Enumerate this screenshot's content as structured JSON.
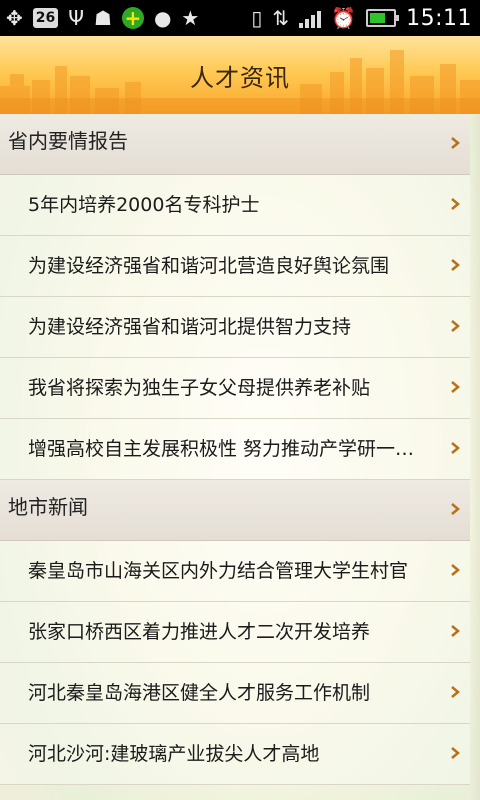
{
  "status_bar": {
    "badge": "26",
    "time": "15:11"
  },
  "header": {
    "title": "人才资讯"
  },
  "sections": [
    {
      "title": "省内要情报告",
      "items": [
        "5年内培养2000名专科护士",
        "为建设经济强省和谐河北营造良好舆论氛围",
        "为建设经济强省和谐河北提供智力支持",
        "我省将探索为独生子女父母提供养老补贴",
        "增强高校自主发展积极性 努力推动产学研一…"
      ]
    },
    {
      "title": "地市新闻",
      "items": [
        "秦皇岛市山海关区内外力结合管理大学生村官",
        "张家口桥西区着力推进人才二次开发培养",
        "河北秦皇岛海港区健全人才服务工作机制",
        "河北沙河:建玻璃产业拔尖人才高地"
      ]
    }
  ],
  "colors": {
    "header_top": "#ffe39a",
    "header_bottom": "#f9a62a",
    "chevron": "#c07a14",
    "section_bg": "#e8e2d9"
  }
}
